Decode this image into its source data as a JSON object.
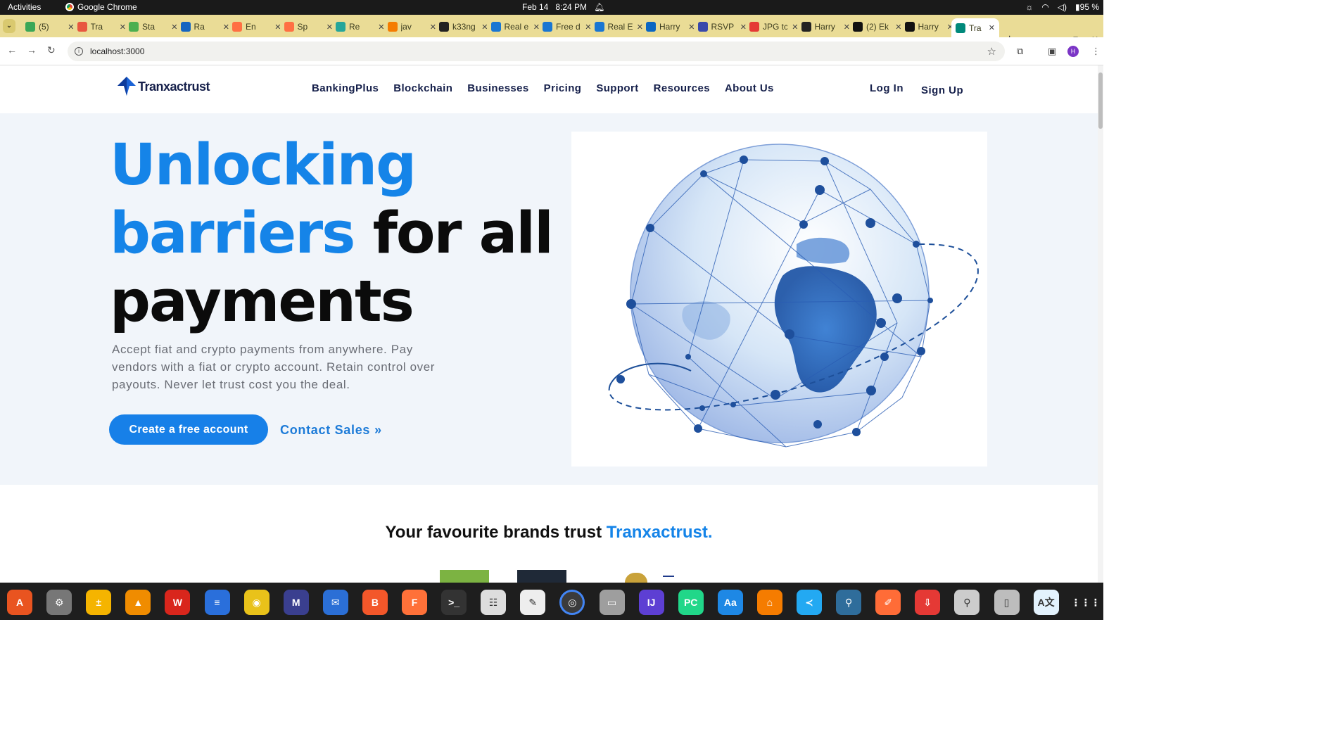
{
  "system": {
    "activities": "Activities",
    "app_name": "Google Chrome",
    "date": "Feb 14",
    "time": "8:24 PM",
    "battery": "95 %"
  },
  "tabs": [
    {
      "label": "(5)",
      "color": "#3aa757"
    },
    {
      "label": "Tra",
      "color": "#e8573f"
    },
    {
      "label": "Sta",
      "color": "#4caf50"
    },
    {
      "label": "Ra",
      "color": "#1565c0"
    },
    {
      "label": "En",
      "color": "#ff7043"
    },
    {
      "label": "Sp",
      "color": "#ff7043"
    },
    {
      "label": "Re",
      "color": "#26a69a"
    },
    {
      "label": "jav",
      "color": "#f57c00"
    },
    {
      "label": "k33ng",
      "color": "#222222"
    },
    {
      "label": "Real e",
      "color": "#1976d2"
    },
    {
      "label": "Free d",
      "color": "#1976d2"
    },
    {
      "label": "Real E",
      "color": "#1976d2"
    },
    {
      "label": "Harry",
      "color": "#0a66c2"
    },
    {
      "label": "RSVP",
      "color": "#3949ab"
    },
    {
      "label": "JPG tc",
      "color": "#e53935"
    },
    {
      "label": "Harry",
      "color": "#222222"
    },
    {
      "label": "(2) Ek",
      "color": "#111111"
    },
    {
      "label": "Harry",
      "color": "#111111"
    },
    {
      "label": "Tra",
      "color": "#00897b",
      "active": true
    }
  ],
  "address": {
    "url": "localhost:3000"
  },
  "profile_initial": "H",
  "site": {
    "logo_text": "Tranxactrust",
    "menu": [
      "BankingPlus",
      "Blockchain",
      "Businesses",
      "Pricing",
      "Support",
      "Resources",
      "About Us"
    ],
    "login": "Log In",
    "signup": "Sign Up",
    "headline": {
      "blue_1": "Unlocking",
      "blue_2": "barriers",
      "dark_1": "for all",
      "dark_2": "payments"
    },
    "subtext": "Accept fiat and crypto payments from anywhere. Pay vendors with a fiat or crypto account. Retain control over payouts. Never let trust cost you the deal.",
    "cta": "Create a free account",
    "contact": "Contact Sales",
    "trust_prefix": "Your favourite brands trust",
    "trust_brand": "Tranxactrust."
  },
  "colors": {
    "accent_blue": "#1584e8",
    "navy": "#16204b",
    "tab_strip": "#eadc96"
  },
  "dock": [
    {
      "name": "app-center",
      "glyph": "A",
      "color": "#e95420"
    },
    {
      "name": "settings",
      "glyph": "⚙",
      "color": "#777777"
    },
    {
      "name": "calculator",
      "glyph": "±",
      "color": "#f5b400"
    },
    {
      "name": "vlc",
      "glyph": "▲",
      "color": "#f08c00"
    },
    {
      "name": "wps-writer",
      "glyph": "W",
      "color": "#d9261c"
    },
    {
      "name": "text-document",
      "glyph": "≡",
      "color": "#2a6fdb"
    },
    {
      "name": "rhythmbox",
      "glyph": "◉",
      "color": "#e9c21a"
    },
    {
      "name": "mail",
      "glyph": "M",
      "color": "#3a3f8f"
    },
    {
      "name": "thunderbird",
      "glyph": "✉",
      "color": "#2b6fd6"
    },
    {
      "name": "brave",
      "glyph": "B",
      "color": "#f3572a"
    },
    {
      "name": "firefox",
      "glyph": "F",
      "color": "#ff7139"
    },
    {
      "name": "terminal",
      "glyph": ">_",
      "color": "#333333"
    },
    {
      "name": "document-viewer",
      "glyph": "☷",
      "color": "#dddddd"
    },
    {
      "name": "text-editor",
      "glyph": "✎",
      "color": "#eeeeee"
    },
    {
      "name": "chrome",
      "glyph": "◎",
      "color": "#4285f4",
      "active": true
    },
    {
      "name": "files",
      "glyph": "▭",
      "color": "#9e9e9e"
    },
    {
      "name": "intellij",
      "glyph": "IJ",
      "color": "#5d3fd3"
    },
    {
      "name": "pycharm",
      "glyph": "PC",
      "color": "#21d789"
    },
    {
      "name": "dictionary",
      "glyph": "Aa",
      "color": "#1e88e5"
    },
    {
      "name": "network-app",
      "glyph": "⌂",
      "color": "#f57c00"
    },
    {
      "name": "vscode",
      "glyph": "≺",
      "color": "#23a9f2"
    },
    {
      "name": "mysql-workbench",
      "glyph": "⚲",
      "color": "#2f6d9b"
    },
    {
      "name": "postman",
      "glyph": "✐",
      "color": "#ff6c37"
    },
    {
      "name": "downloader",
      "glyph": "⇩",
      "color": "#e53935"
    },
    {
      "name": "search",
      "glyph": "⚲",
      "color": "#cccccc"
    },
    {
      "name": "archive",
      "glyph": "▯",
      "color": "#bdbdbd"
    },
    {
      "name": "translate",
      "glyph": "A文",
      "color": "#e3f2fd"
    },
    {
      "name": "show-apps",
      "glyph": "⋮⋮⋮",
      "color": "#1e1e1e"
    }
  ]
}
